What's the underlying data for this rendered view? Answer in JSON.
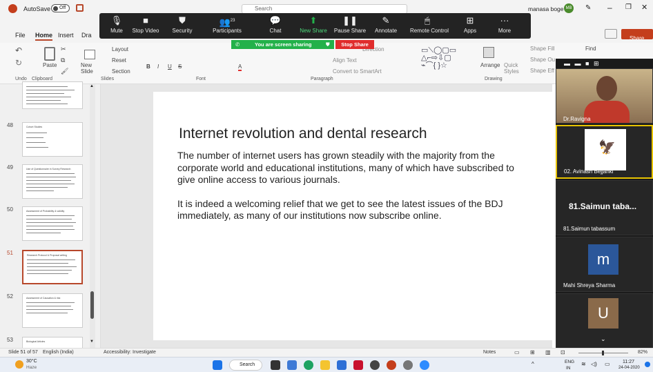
{
  "titlebar": {
    "autosave_label": "AutoSave",
    "autosave_state": "Off",
    "user_name": "manasa boge",
    "user_initials": "MB",
    "search_placeholder": "Search"
  },
  "menu": {
    "tabs": [
      "File",
      "Home",
      "Insert",
      "Dra"
    ],
    "share_label": "Share"
  },
  "ribbon": {
    "undo_label": "Undo",
    "clipboard_label": "Clipboard",
    "slides_label": "Slides",
    "font_label": "Font",
    "paragraph_label": "Paragraph",
    "drawing_label": "Drawing",
    "paste_label": "Paste",
    "new_slide_label": "New Slide",
    "layout_label": "Layout",
    "reset_label": "Reset",
    "section_label": "Section",
    "align_text_label": "Align Text",
    "convert_smartart_label": "Convert to SmartArt",
    "arrange_label": "Arrange",
    "quick_styles_label": "Quick Styles",
    "shape_fill_label": "Shape Fill",
    "shape_outline_label": "Shape Ou",
    "shape_effects_label": "Shape Eff",
    "find_label": "Find",
    "direction_label": "Direction"
  },
  "zoom_toolbar": {
    "items": [
      "Mute",
      "Stop Video",
      "Security",
      "Participants",
      "Chat",
      "New Share",
      "Pause Share",
      "Annotate",
      "Remote Control",
      "Apps",
      "More"
    ],
    "participants_count": "23"
  },
  "share_banner": {
    "text": "You are screen sharing",
    "stop_label": "Stop Share"
  },
  "thumbnails": {
    "numbers": [
      "48",
      "49",
      "50",
      "51",
      "52",
      "53"
    ],
    "titles": [
      "",
      "Cohort Studies",
      "Use of Questionnaire in Survey Research",
      "Assessment of Probability & validity",
      "Research Protocol & Proposal writing",
      "Assessment of Causation & risk",
      "Biological Articles"
    ]
  },
  "slide": {
    "title": "Internet revolution and dental research",
    "para1": "The number of internet users has grown steadily with the majority from the corporate world and educational institutions, many of which have subscribed to give online access to various journals.",
    "para2": "It is indeed a welcoming relief that we get to see the latest issues of the BDJ immediately, as many of our institutions now subscribe online."
  },
  "video_panel": {
    "participants": [
      "Dr.Ravigna",
      "02. Avinash Bejjanki",
      "81.Saimun taba...",
      "81.Saimun tabassum",
      "Mahi Shreya Sharma"
    ],
    "avatars": [
      "m",
      "U"
    ]
  },
  "statusbar": {
    "slide_info": "Slide 51 of 57",
    "language": "English (India)",
    "accessibility": "Accessibility: Investigate",
    "notes_label": "Notes",
    "zoom": "82%"
  },
  "taskbar": {
    "weather_temp": "30°C",
    "weather_desc": "Haze",
    "search_label": "Search",
    "lang": "ENG",
    "lang2": "IN",
    "time": "11:27",
    "date": "24-04-2020"
  },
  "colors": {
    "accent_red": "#b7472a",
    "zoom_green": "#23b14a",
    "stop_red": "#e02d2d",
    "avatar_blue": "#2b579a"
  }
}
